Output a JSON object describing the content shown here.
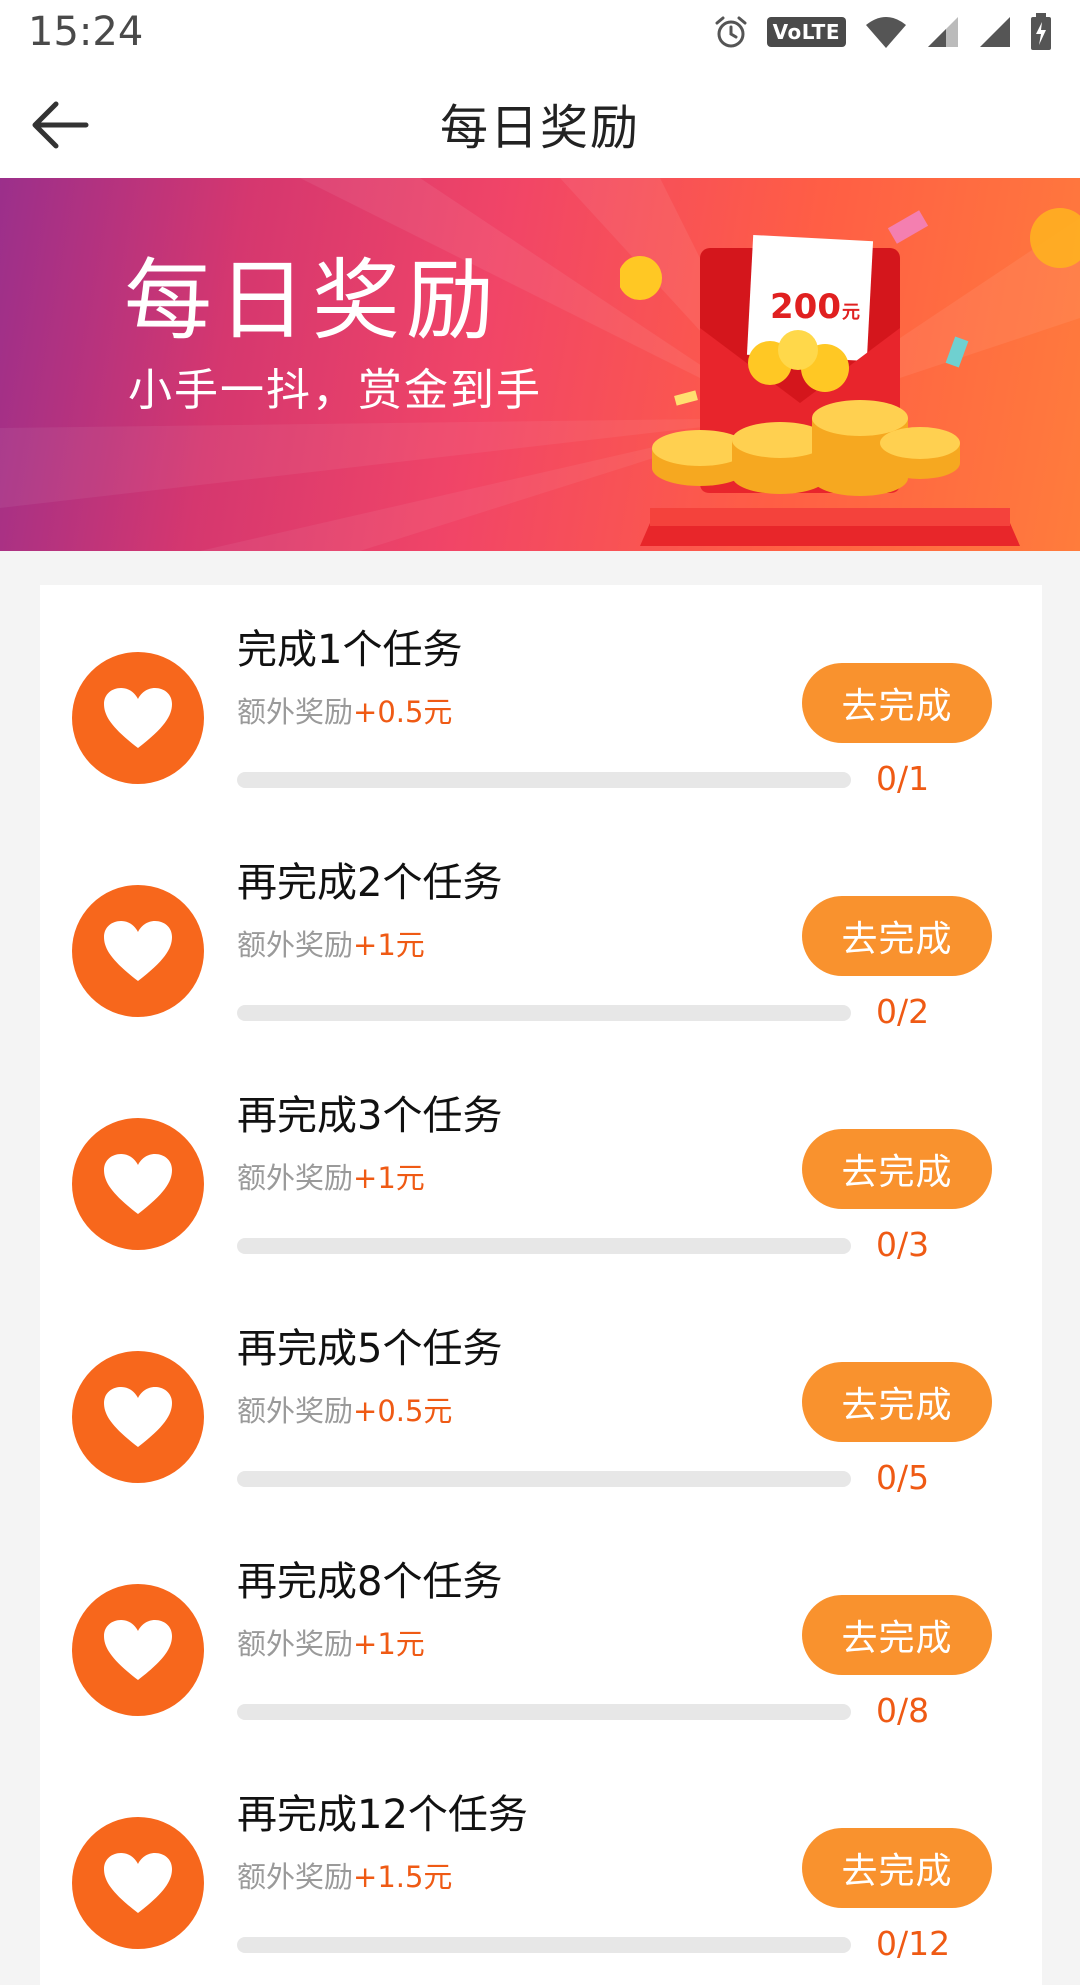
{
  "status_bar": {
    "time": "15:24",
    "volte": "VoLTE",
    "icons": [
      "alarm-icon",
      "wifi-icon",
      "signal-icon",
      "battery-charging-icon"
    ]
  },
  "header": {
    "title": "每日奖励",
    "back_icon": "back-arrow-icon"
  },
  "banner": {
    "title": "每日奖励",
    "subtitle": "小手一抖，赏金到手",
    "envelope_amount": "200",
    "envelope_unit": "元"
  },
  "tasks": [
    {
      "title": "完成1个任务",
      "reward_label": "额外奖励",
      "reward_amount": "+0.5元",
      "button_label": "去完成",
      "progress": "0/1",
      "progress_fraction": 0
    },
    {
      "title": "再完成2个任务",
      "reward_label": "额外奖励",
      "reward_amount": "+1元",
      "button_label": "去完成",
      "progress": "0/2",
      "progress_fraction": 0
    },
    {
      "title": "再完成3个任务",
      "reward_label": "额外奖励",
      "reward_amount": "+1元",
      "button_label": "去完成",
      "progress": "0/3",
      "progress_fraction": 0
    },
    {
      "title": "再完成5个任务",
      "reward_label": "额外奖励",
      "reward_amount": "+0.5元",
      "button_label": "去完成",
      "progress": "0/5",
      "progress_fraction": 0
    },
    {
      "title": "再完成8个任务",
      "reward_label": "额外奖励",
      "reward_amount": "+1元",
      "button_label": "去完成",
      "progress": "0/8",
      "progress_fraction": 0
    },
    {
      "title": "再完成12个任务",
      "reward_label": "额外奖励",
      "reward_amount": "+1.5元",
      "button_label": "去完成",
      "progress": "0/12",
      "progress_fraction": 0
    }
  ],
  "colors": {
    "accent": "#f9922e",
    "heart_badge": "#f7671c",
    "reward_amount": "#ef5a14",
    "progress_track": "#e7e7e7"
  }
}
